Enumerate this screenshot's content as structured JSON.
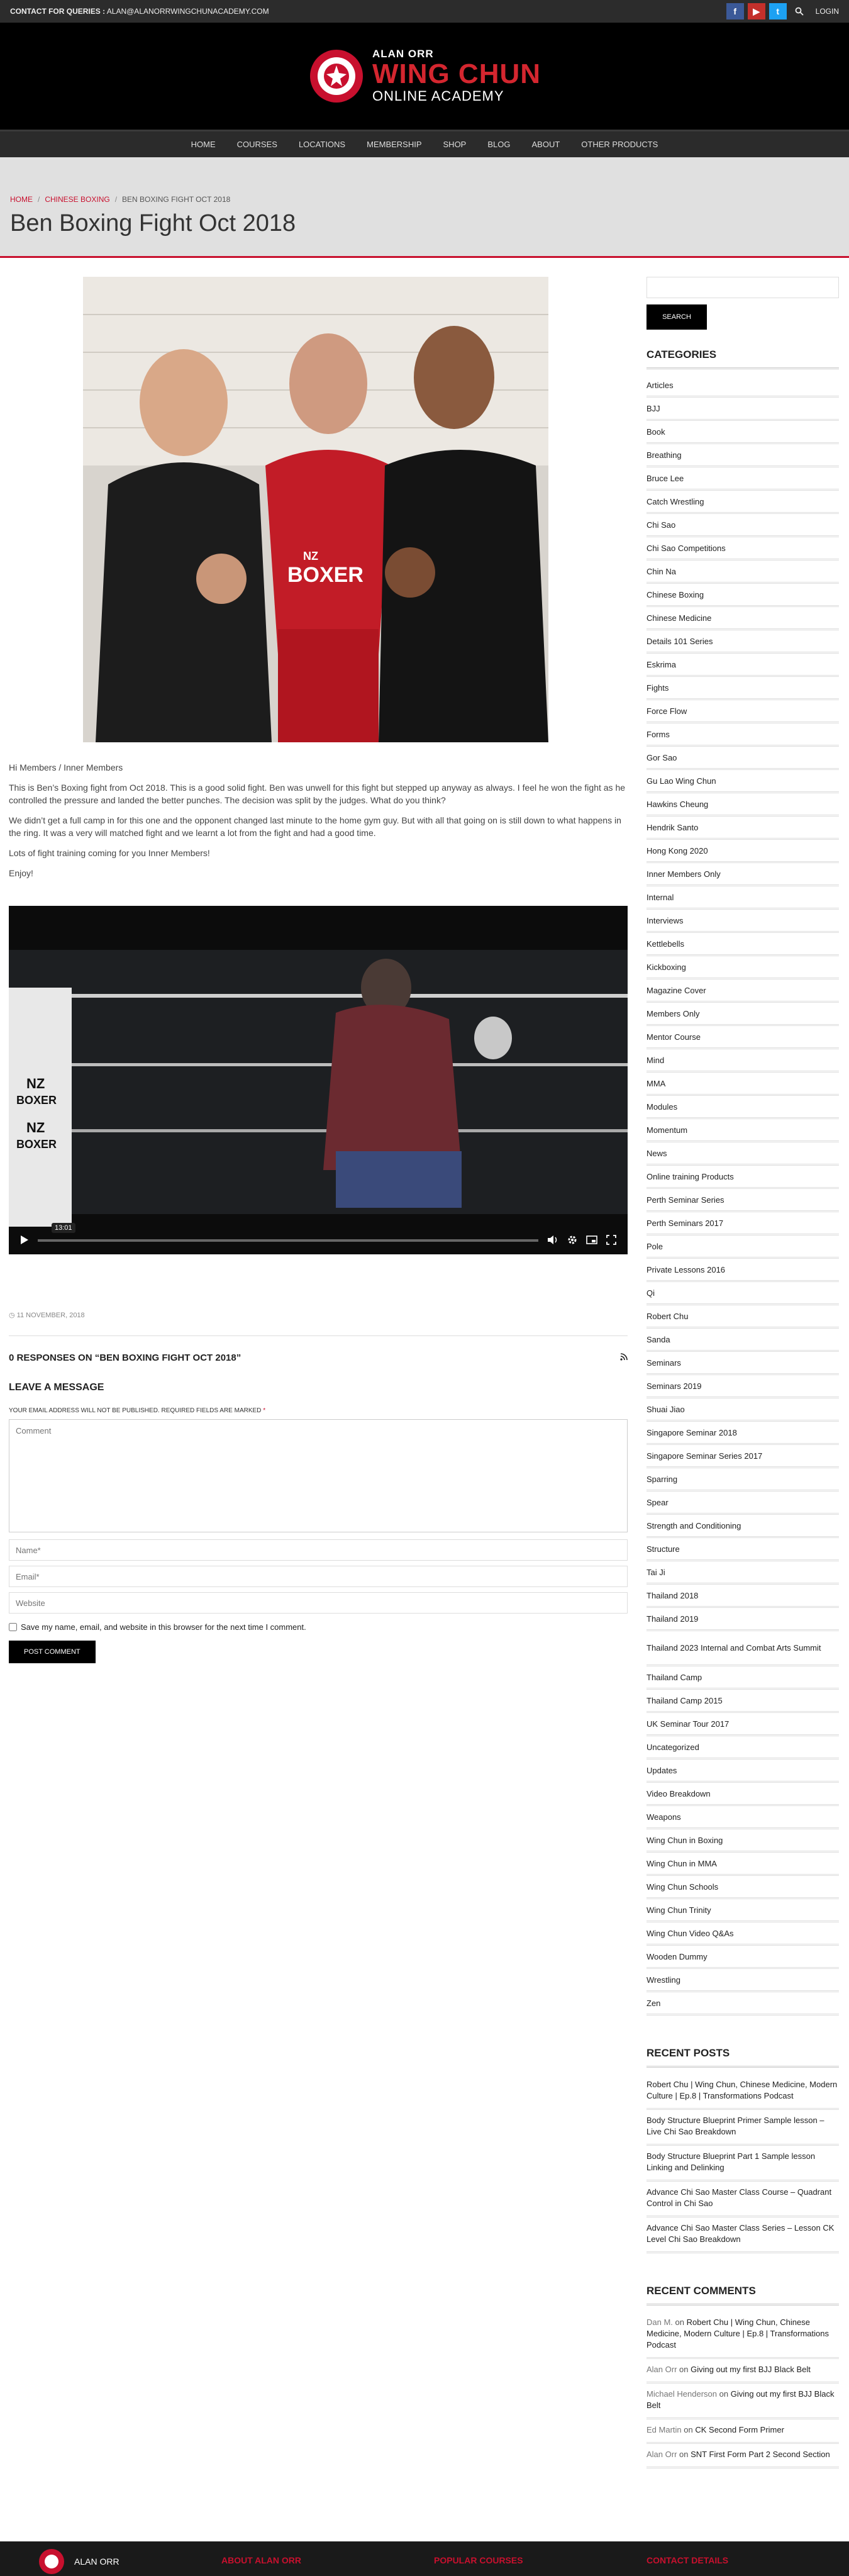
{
  "topbar": {
    "contact_label": "CONTACT FOR QUERIES :",
    "contact_email": "ALAN@ALANORRWINGCHUNACADEMY.COM",
    "login": "LOGIN",
    "facebook_glyph": "f",
    "youtube_glyph": "▶",
    "twitter_glyph": "t"
  },
  "brand": {
    "line1": "ALAN ORR",
    "line2": "WING CHUN",
    "line3": "ONLINE ACADEMY",
    "accent": "#c8102e"
  },
  "nav": [
    "HOME",
    "COURSES",
    "LOCATIONS",
    "MEMBERSHIP",
    "SHOP",
    "BLOG",
    "ABOUT",
    "OTHER PRODUCTS"
  ],
  "breadcrumb": {
    "home": "HOME",
    "section": "CHINESE BOXING",
    "current": "BEN BOXING FIGHT OCT 2018"
  },
  "page_title": "Ben Boxing Fight Oct 2018",
  "post": {
    "paragraphs": [
      "Hi Members / Inner Members",
      "This is Ben’s Boxing fight from Oct 2018. This is a good solid fight. Ben was unwell for this fight but stepped up anyway as always. I feel he won the fight as he controlled the pressure and landed the better punches. The decision was split by the judges. What do you think?",
      "We didn’t get a full camp in for this one and the opponent changed last minute to the home gym guy. But with all that going on is still down to what happens in the ring. It was a very will matched fight and we learnt a lot from the fight and had a good time.",
      "Lots of fight training coming for you Inner Members!",
      "Enjoy!"
    ],
    "photo_text": {
      "nz": "NZ",
      "boxer": "BOXER"
    },
    "video": {
      "time": "13:01",
      "ring_text": [
        "NZ",
        "BOXER",
        "NZ",
        "BOXER"
      ],
      "progress": 0.0
    },
    "date": "11 NOVEMBER, 2018"
  },
  "comments": {
    "responses": "0 RESPONSES ON “BEN BOXING FIGHT OCT 2018”",
    "leave": "LEAVE A MESSAGE",
    "note": "YOUR EMAIL ADDRESS WILL NOT BE PUBLISHED. REQUIRED FIELDS ARE MARKED",
    "required_mark": "*",
    "comment_placeholder": "Comment",
    "name_placeholder": "Name*",
    "email_placeholder": "Email*",
    "website_placeholder": "Website",
    "save_label": "Save my name, email, and website in this browser for the next time I comment.",
    "submit": "POST COMMENT"
  },
  "sidebar": {
    "search_button": "SEARCH",
    "categories_title": "CATEGORIES",
    "categories": [
      "Articles",
      "BJJ",
      "Book",
      "Breathing",
      "Bruce Lee",
      "Catch Wrestling",
      "Chi Sao",
      "Chi Sao Competitions",
      "Chin Na",
      "Chinese Boxing",
      "Chinese Medicine",
      "Details 101 Series",
      "Eskrima",
      "Fights",
      "Force Flow",
      "Forms",
      "Gor Sao",
      "Gu Lao Wing Chun",
      "Hawkins Cheung",
      "Hendrik Santo",
      "Hong Kong 2020",
      "Inner Members Only",
      "Internal",
      "Interviews",
      "Kettlebells",
      "Kickboxing",
      "Magazine Cover",
      "Members Only",
      "Mentor Course",
      "Mind",
      "MMA",
      "Modules",
      "Momentum",
      "News",
      "Online training Products",
      "Perth Seminar Series",
      "Perth Seminars 2017",
      "Pole",
      "Private Lessons 2016",
      "Qi",
      "Robert Chu",
      "Sanda",
      "Seminars",
      "Seminars 2019",
      "Shuai Jiao",
      "Singapore Seminar 2018",
      "Singapore Seminar Series 2017",
      "Sparring",
      "Spear",
      "Strength and Conditioning",
      "Structure",
      "Tai Ji",
      "Thailand 2018",
      "Thailand 2019",
      "Thailand 2023 Internal and Combat Arts Summit",
      "Thailand Camp",
      "Thailand Camp 2015",
      "UK Seminar Tour 2017",
      "Uncategorized",
      "Updates",
      "Video Breakdown",
      "Weapons",
      "Wing Chun in Boxing",
      "Wing Chun in MMA",
      "Wing Chun Schools",
      "Wing Chun Trinity",
      "Wing Chun Video Q&As",
      "Wooden Dummy",
      "Wrestling",
      "Zen"
    ],
    "recent_posts_title": "RECENT POSTS",
    "recent_posts": [
      "Robert Chu | Wing Chun, Chinese Medicine, Modern Culture | Ep.8 | Transformations Podcast",
      "Body Structure Blueprint Primer Sample lesson – Live Chi Sao Breakdown",
      "Body Structure Blueprint Part 1 Sample lesson Linking and Delinking",
      "Advance Chi Sao Master Class Course – Quadrant Control in Chi Sao",
      "Advance Chi Sao Master Class Series – Lesson CK Level Chi Sao Breakdown"
    ],
    "recent_comments_title": "RECENT COMMENTS",
    "recent_comments": [
      {
        "author": "Dan M.",
        "on": "on",
        "post": "Robert Chu | Wing Chun, Chinese Medicine, Modern Culture | Ep.8 | Transformations Podcast"
      },
      {
        "author": "Alan Orr",
        "on": "on",
        "post": "Giving out my first BJJ Black Belt"
      },
      {
        "author": "Michael Henderson",
        "on": "on",
        "post": "Giving out my first BJJ Black Belt"
      },
      {
        "author": "Ed Martin",
        "on": "on",
        "post": "CK Second Form Primer"
      },
      {
        "author": "Alan Orr",
        "on": "on",
        "post": "SNT First Form Part 2 Second Section"
      }
    ]
  },
  "footer": {
    "brand": "ALAN ORR",
    "about": "ABOUT ALAN ORR",
    "popular": "POPULAR COURSES",
    "contact": "CONTACT DETAILS"
  }
}
